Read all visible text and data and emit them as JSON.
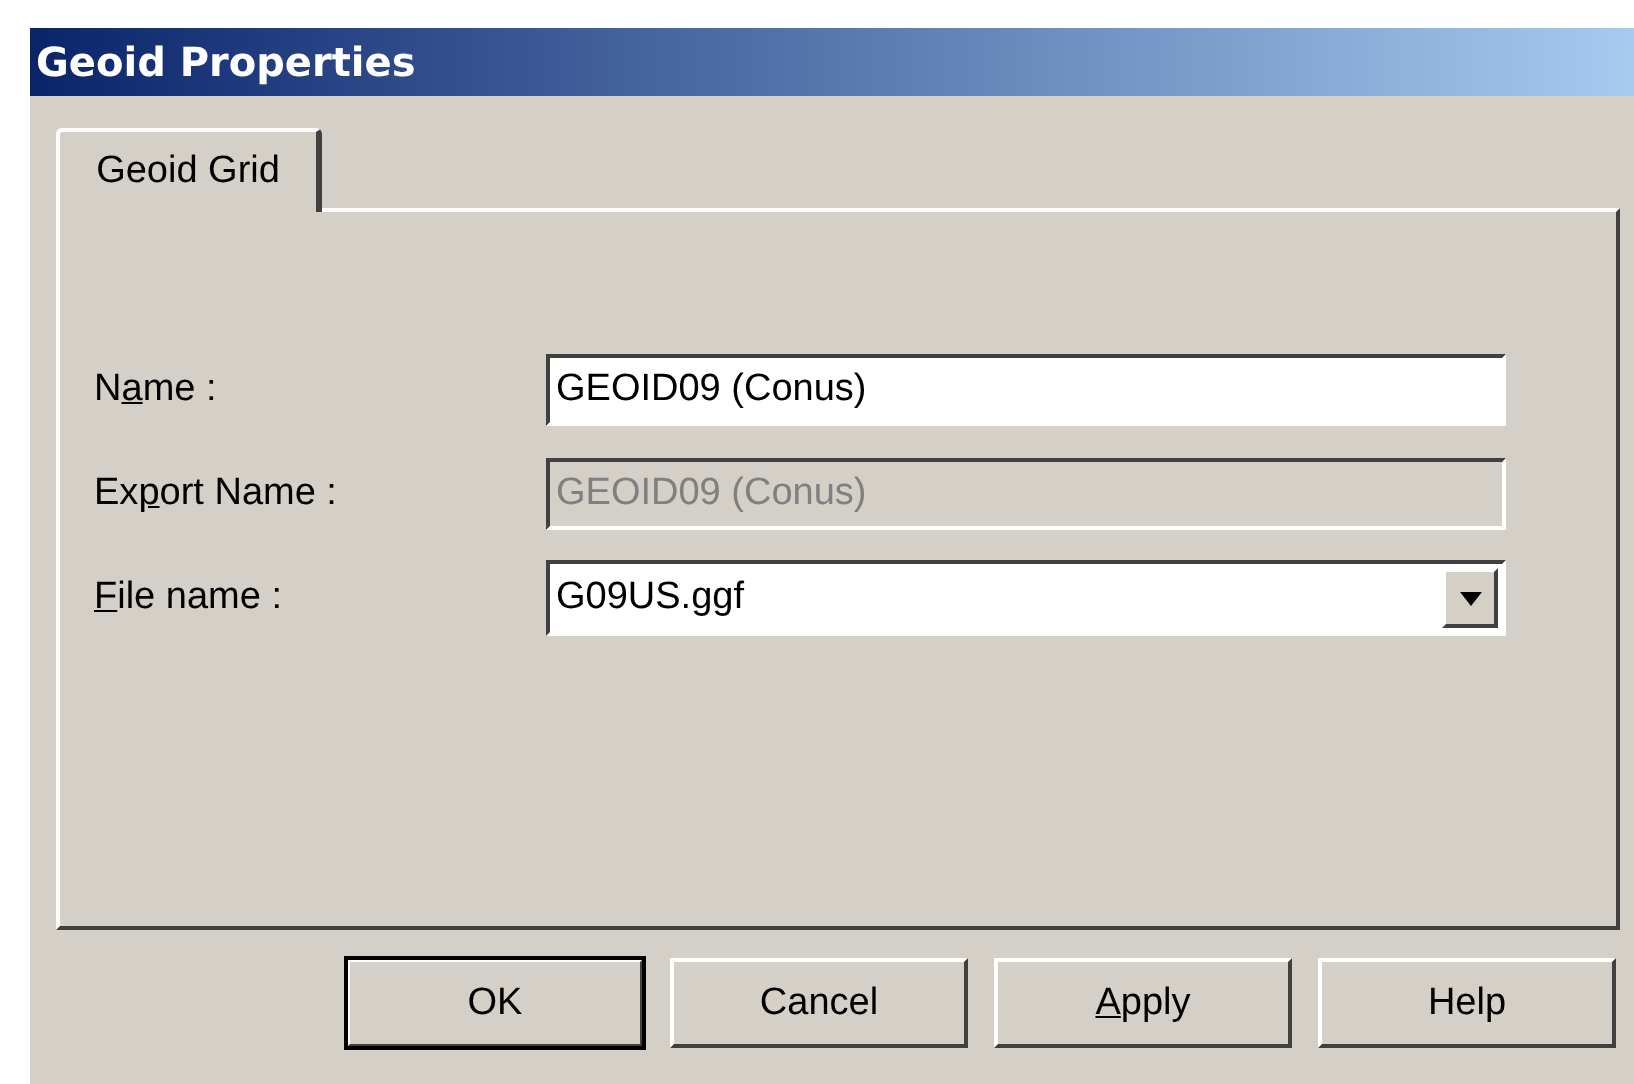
{
  "window": {
    "title": "Geoid Properties"
  },
  "tabs": [
    {
      "label": "Geoid Grid",
      "selected": true
    }
  ],
  "fields": [
    {
      "kind": "text",
      "label": {
        "pre": "N",
        "key": "a",
        "post": "me :"
      },
      "value": "GEOID09 (Conus)",
      "disabled": false
    },
    {
      "kind": "text",
      "label": {
        "pre": "Ex",
        "key": "p",
        "post": "ort Name :"
      },
      "value": "GEOID09 (Conus)",
      "disabled": true
    },
    {
      "kind": "dropdown",
      "label": {
        "key": "F",
        "post": "ile name :"
      },
      "value": "G09US.ggf",
      "disabled": false
    }
  ],
  "buttons": [
    {
      "label": {
        "pre": "OK"
      },
      "default": true
    },
    {
      "label": {
        "pre": "Cancel"
      },
      "default": false
    },
    {
      "label": {
        "key": "A",
        "post": "pply"
      },
      "default": false
    },
    {
      "label": {
        "pre": "Help"
      },
      "default": false
    }
  ]
}
